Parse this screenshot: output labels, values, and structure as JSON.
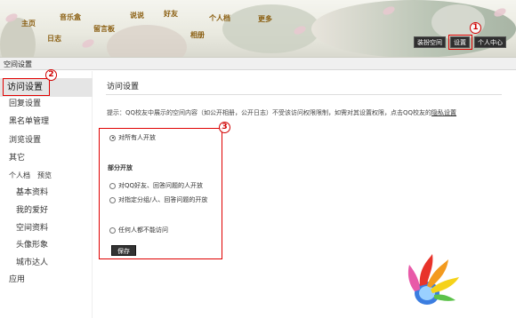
{
  "nav": {
    "home": "主页",
    "diary": "日志",
    "music": "音乐盒",
    "guestbook": "留言板",
    "talk": "说说",
    "friends": "好友",
    "album": "相册",
    "profile": "个人档",
    "more": "更多"
  },
  "toolbar": {
    "decorate": "装扮空间",
    "settings": "设置",
    "personal_center": "个人中心"
  },
  "annotations": {
    "one": "1",
    "two": "2",
    "three": "3",
    "color": "#e00000"
  },
  "section_title": "空间设置",
  "sidebar": {
    "items": [
      {
        "label": "访问设置"
      },
      {
        "label": "回复设置"
      },
      {
        "label": "黑名单管理"
      },
      {
        "label": "浏览设置"
      },
      {
        "label": "其它"
      },
      {
        "label": "个人档"
      },
      {
        "label": "预览"
      },
      {
        "label": "基本资料"
      },
      {
        "label": "我的爱好"
      },
      {
        "label": "空间资料"
      },
      {
        "label": "头像形象"
      },
      {
        "label": "城市达人"
      },
      {
        "label": "应用"
      }
    ]
  },
  "main": {
    "title": "访问设置",
    "hint_prefix": "提示：QQ校友中展示的空间内容（如公开相册，公开日志）不受该访问权限限制，如需对其设置权限，点击QQ校友的",
    "hint_link": "隐私设置",
    "options": {
      "all": "对所有人开放",
      "partial_heading": "部分开放",
      "qq_friends": "对QQ好友、回答问题的人开放",
      "groups": "对指定分组/人、回答问题的开放",
      "none": "任何人都不能访问"
    },
    "save_label": "保存"
  }
}
